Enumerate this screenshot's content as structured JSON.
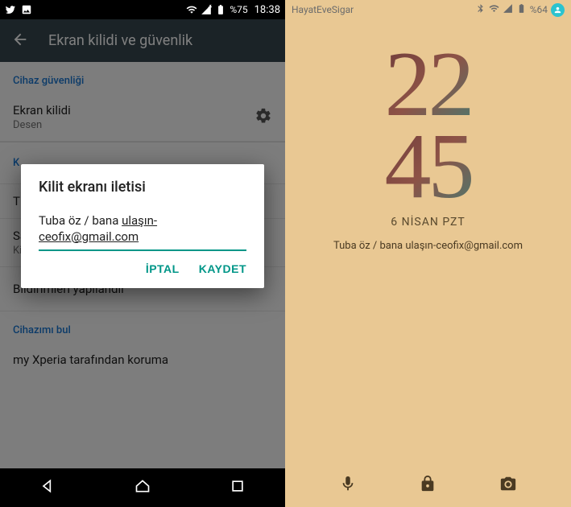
{
  "left": {
    "status": {
      "battery_text": "%75",
      "time": "18:38"
    },
    "appbar": {
      "title": "Ekran kilidi ve güvenlik"
    },
    "sections": {
      "device_security_label": "Cihaz güvenliği",
      "find_device_label": "Cihazımı bul"
    },
    "rows": {
      "lock": {
        "primary": "Ekran kilidi",
        "secondary": "Desen"
      },
      "row2_trunc_primary": "K",
      "row3_trunc_primary": "T",
      "clocks": {
        "primary": "Saatler",
        "secondary": "Kilit ekranında saati değiştir"
      },
      "notifications": {
        "primary": "Bildirimleri yapılandır"
      },
      "xperia": {
        "primary": "my Xperia tarafından koruma"
      }
    },
    "dialog": {
      "title": "Kilit ekranı iletisi",
      "value_line1": "Tuba öz / bana ",
      "value_underlined1": "ulaşın-",
      "value_underlined2": "ceofix@gmail.com",
      "cancel": "İPTAL",
      "save": "KAYDET"
    }
  },
  "right": {
    "status": {
      "app_label": "HayatEveSigar",
      "battery_text": "%64"
    },
    "clock": {
      "hours": "22",
      "minutes": "45"
    },
    "date": "6 NİSAN PZT",
    "lock_message": "Tuba öz / bana ulaşın-ceofix@gmail.com"
  }
}
